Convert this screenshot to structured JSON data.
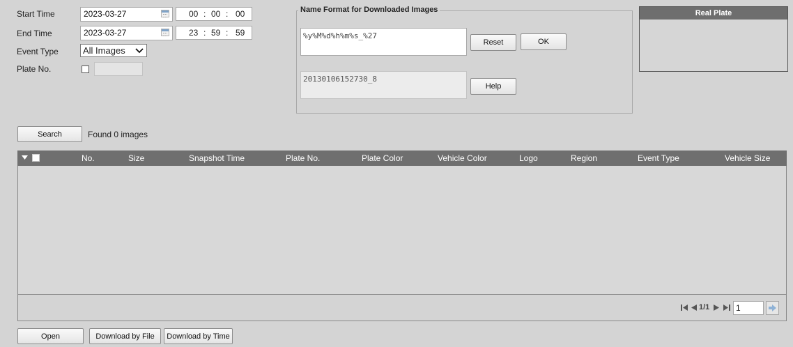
{
  "form": {
    "start_time_label": "Start Time",
    "start_date": "2023-03-27",
    "start_hh": "00",
    "start_mm": "00",
    "start_ss": "00",
    "end_time_label": "End Time",
    "end_date": "2023-03-27",
    "end_hh": "23",
    "end_mm": "59",
    "end_ss": "59",
    "time_sep": ":",
    "event_type_label": "Event Type",
    "event_type_value": "All Images",
    "plate_no_label": "Plate No.",
    "plate_no_value": ""
  },
  "name_format": {
    "legend": "Name Format for Downloaded Images",
    "format_value": "%y%M%d%h%m%s_%27",
    "reset_label": "Reset",
    "ok_label": "OK",
    "example_value": "20130106152730_8",
    "help_label": "Help"
  },
  "real_plate": {
    "title": "Real Plate"
  },
  "search": {
    "button_label": "Search",
    "result_text": "Found 0 images"
  },
  "table": {
    "columns": [
      "No.",
      "Size",
      "Snapshot Time",
      "Plate No.",
      "Plate Color",
      "Vehicle Color",
      "Logo",
      "Region",
      "Event Type",
      "Vehicle Size"
    ],
    "rows": []
  },
  "pagination": {
    "page_text": "1/1",
    "page_input": "1"
  },
  "actions": {
    "open_label": "Open",
    "download_file_label": "Download by File",
    "download_time_label": "Download by Time"
  },
  "colors": {
    "background": "#d4d4d4",
    "header_bar": "#6f6f6f",
    "real_plate_header": "#6e6e6e"
  }
}
